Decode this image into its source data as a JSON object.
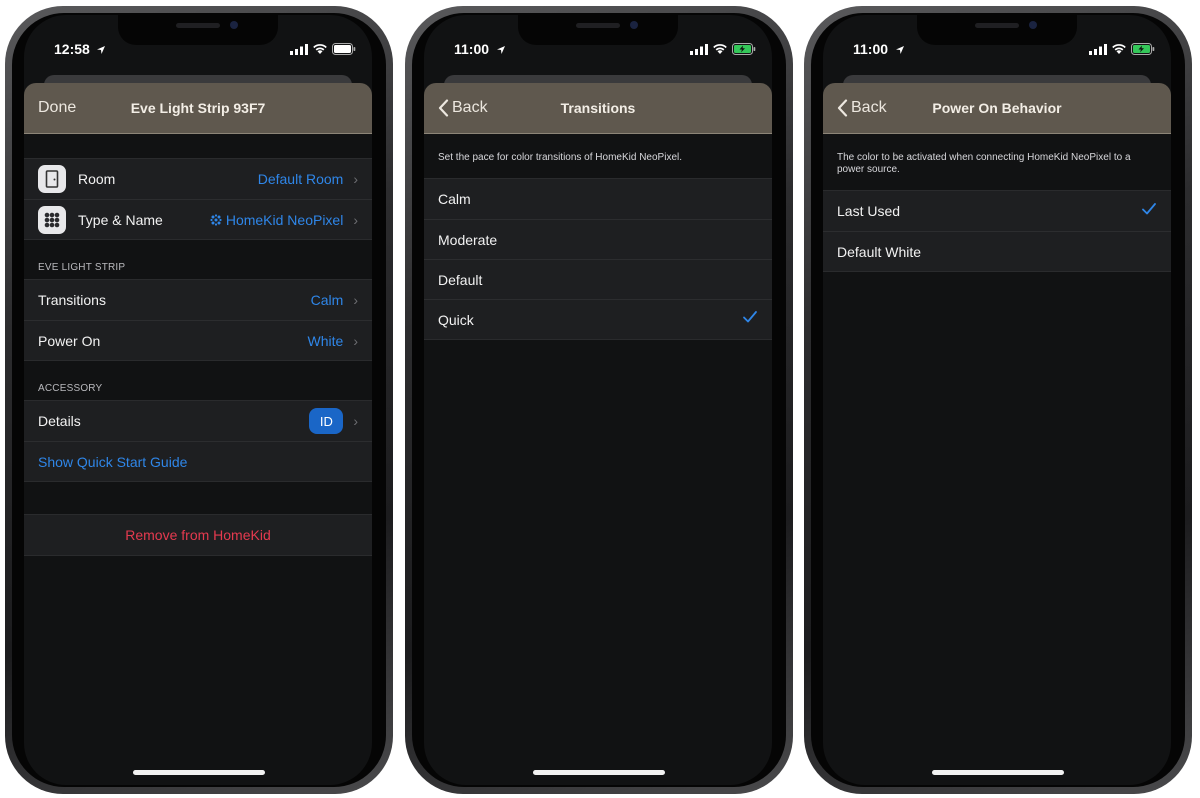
{
  "screens": [
    {
      "status_time": "12:58",
      "nav_left": "Done",
      "nav_title": "Eve Light Strip 93F7",
      "rows_top": [
        {
          "label": "Room",
          "value": "Default Room",
          "icon": "door-icon"
        },
        {
          "label": "Type & Name",
          "value": "HomeKid NeoPixel",
          "icon": "light-strip-icon"
        }
      ],
      "section1_header": "EVE LIGHT STRIP",
      "rows_mid": [
        {
          "label": "Transitions",
          "value": "Calm"
        },
        {
          "label": "Power On",
          "value": "White"
        }
      ],
      "section2_header": "ACCESSORY",
      "details_label": "Details",
      "details_badge": "ID",
      "quick_start": "Show Quick Start Guide",
      "remove": "Remove from HomeKid"
    },
    {
      "status_time": "11:00",
      "nav_left": "Back",
      "nav_title": "Transitions",
      "description": "Set the pace for color transitions of HomeKid NeoPixel.",
      "options": [
        "Calm",
        "Moderate",
        "Default",
        "Quick"
      ],
      "selected": "Quick"
    },
    {
      "status_time": "11:00",
      "nav_left": "Back",
      "nav_title": "Power On Behavior",
      "description": "The color to be activated when connecting HomeKid NeoPixel to a power source.",
      "options": [
        "Last Used",
        "Default White"
      ],
      "selected": "Last Used"
    }
  ],
  "colors": {
    "navbar": "#5f584e",
    "accent": "#2f86e8",
    "danger": "#e53a4f",
    "background": "#111213"
  }
}
